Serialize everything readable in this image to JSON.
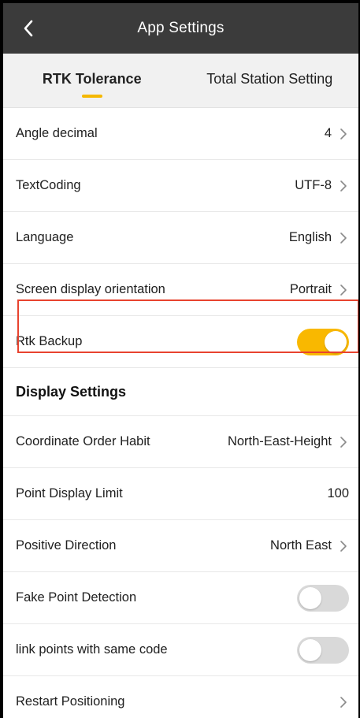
{
  "header": {
    "title": "App Settings"
  },
  "tabs": [
    {
      "label": "RTK Tolerance",
      "active": true
    },
    {
      "label": "Total Station Setting",
      "active": false
    }
  ],
  "general": [
    {
      "label": "Angle decimal",
      "value": "4"
    },
    {
      "label": "TextCoding",
      "value": "UTF-8"
    },
    {
      "label": "Language",
      "value": "English"
    },
    {
      "label": "Screen display orientation",
      "value": "Portrait"
    },
    {
      "label": "Rtk Backup",
      "toggle": true
    }
  ],
  "display_section": {
    "title": "Display Settings",
    "rows": [
      {
        "label": "Coordinate Order Habit",
        "value": "North-East-Height"
      },
      {
        "label": "Point Display Limit",
        "value": "100"
      },
      {
        "label": "Positive Direction",
        "value": "North East"
      },
      {
        "label": "Fake Point Detection",
        "toggle": false
      },
      {
        "label": "link points with same code",
        "toggle": false
      },
      {
        "label": "Restart Positioning",
        "value": ""
      }
    ]
  },
  "colors": {
    "header_bg": "#3b3b3b",
    "accent": "#f9b800",
    "highlight_border": "#e8432f"
  }
}
